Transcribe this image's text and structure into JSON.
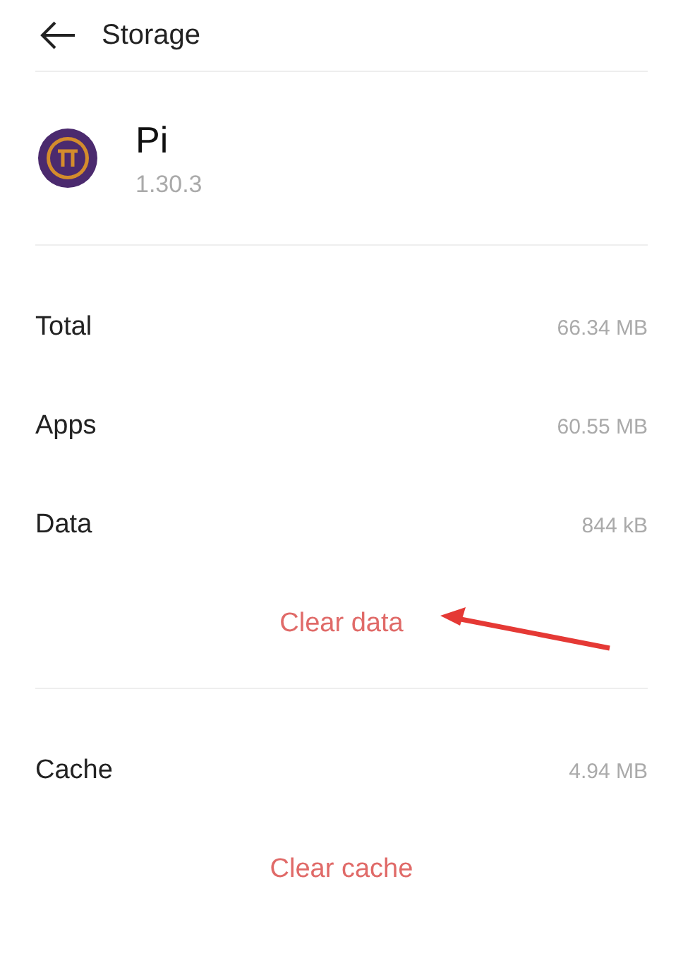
{
  "header": {
    "title": "Storage"
  },
  "app": {
    "name": "Pi",
    "version": "1.30.3"
  },
  "sections": [
    {
      "rows": [
        {
          "label": "Total",
          "value": "66.34 MB"
        },
        {
          "label": "Apps",
          "value": "60.55 MB"
        },
        {
          "label": "Data",
          "value": "844 kB"
        }
      ],
      "action": "Clear data",
      "annotated": true
    },
    {
      "rows": [
        {
          "label": "Cache",
          "value": "4.94 MB"
        }
      ],
      "action": "Clear cache",
      "annotated": false
    }
  ]
}
